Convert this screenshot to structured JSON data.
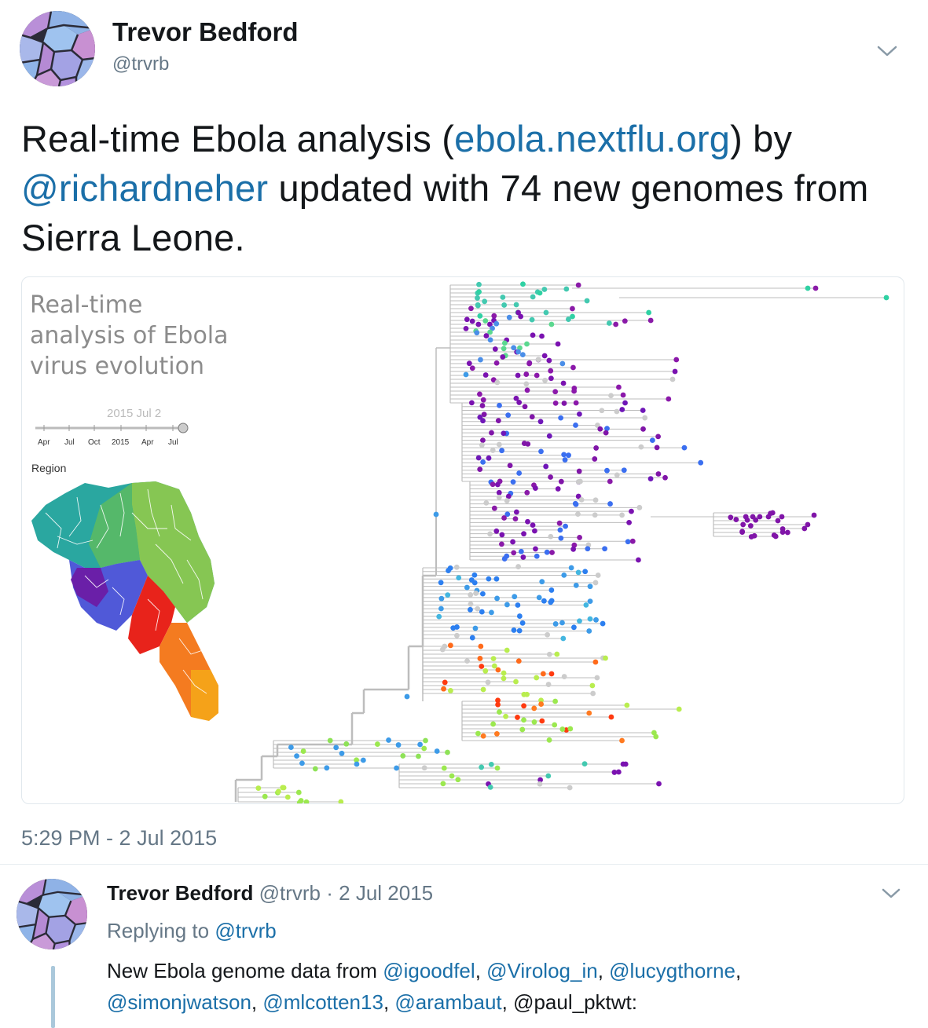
{
  "tweet": {
    "author_name": "Trevor Bedford",
    "author_handle": "@trvrb",
    "text_part1": "Real-time Ebola analysis (",
    "link_text": "ebola.nextflu.org",
    "text_part2": ") by ",
    "mention": "@richardneher",
    "text_part3": " updated with 74 new genomes from Sierra Leone.",
    "timestamp": "5:29 PM - 2 Jul 2015",
    "menu_icon": "chevron-down-icon"
  },
  "media": {
    "title_lines": [
      "Real-time",
      "analysis of Ebola",
      "virus evolution"
    ],
    "date_label": "2015 Jul 2",
    "timeline_ticks": [
      "Apr",
      "Jul",
      "Oct",
      "2015",
      "Apr",
      "Jul"
    ],
    "region_label": "Region"
  },
  "reply": {
    "author_name": "Trevor Bedford",
    "author_handle": "@trvrb",
    "date": "· 2 Jul 2015",
    "replying_prefix": "Replying to ",
    "replying_to": "@trvrb",
    "text_prefix": "New Ebola genome data from ",
    "mentions": [
      "@igoodfel",
      "@Virolog_in",
      "@lucygthorne",
      "@simonjwatson",
      "@mlcotten13",
      "@arambaut",
      "@paul_pktwt"
    ],
    "text_suffix": ":"
  },
  "colors": {
    "link": "#1b6fa8",
    "muted": "#657786",
    "avatar_purple": "#c58fd6",
    "avatar_blue": "#9dbde9"
  }
}
